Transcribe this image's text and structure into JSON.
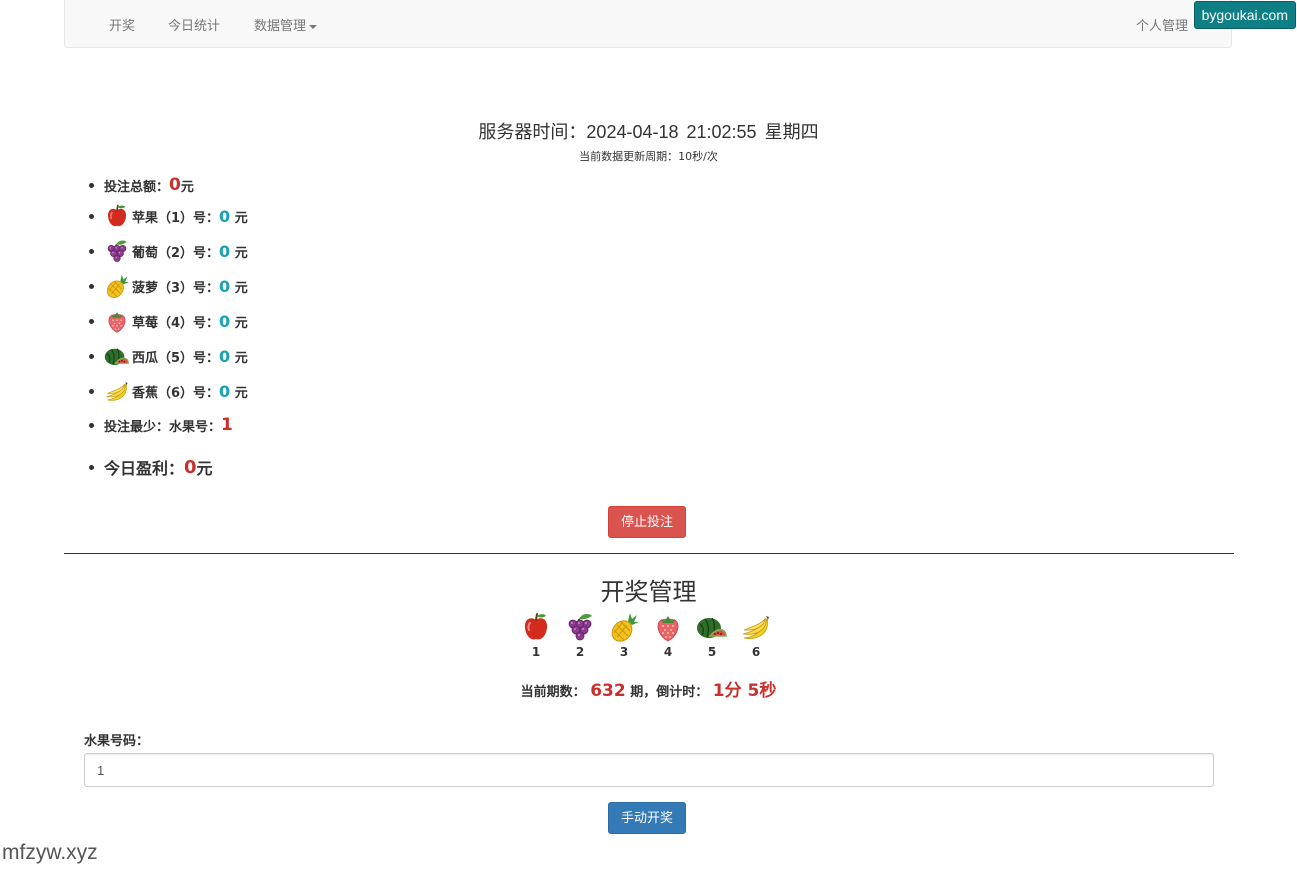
{
  "nav": {
    "items": [
      "开奖",
      "今日统计",
      "数据管理"
    ],
    "right": "个人管理"
  },
  "watermarks": {
    "top": "bygoukai.com",
    "bottom": "mfzyw.xyz"
  },
  "server_time": {
    "label": "服务器时间：",
    "date": "2024-04-18",
    "time": "21:02:55",
    "weekday": "星期四"
  },
  "refresh_text": "当前数据更新周期：10秒/次",
  "stats": {
    "total_label": "投注总额：",
    "total_value": "0",
    "unit": "元",
    "fruits": [
      {
        "icon": "apple-icon",
        "label": "苹果（1）号：",
        "value": "0",
        "unit": "元"
      },
      {
        "icon": "grape-icon",
        "label": "葡萄（2）号：",
        "value": "0",
        "unit": "元"
      },
      {
        "icon": "pineapple-icon",
        "label": "菠萝（3）号：",
        "value": "0",
        "unit": "元"
      },
      {
        "icon": "strawberry-icon",
        "label": "草莓（4）号：",
        "value": "0",
        "unit": "元"
      },
      {
        "icon": "watermelon-icon",
        "label": "西瓜（5）号：",
        "value": "0",
        "unit": "元"
      },
      {
        "icon": "banana-icon",
        "label": "香蕉（6）号：",
        "value": "0",
        "unit": "元"
      }
    ],
    "min_label": "投注最少：水果号：",
    "min_value": "1",
    "profit_label": "今日盈利：",
    "profit_value": "0",
    "profit_unit": "元"
  },
  "stop_button": "停止投注",
  "draw": {
    "title": "开奖管理",
    "fruits": [
      {
        "icon": "apple-icon",
        "num": "1"
      },
      {
        "icon": "grape-icon",
        "num": "2"
      },
      {
        "icon": "pineapple-icon",
        "num": "3"
      },
      {
        "icon": "strawberry-icon",
        "num": "4"
      },
      {
        "icon": "watermelon-icon",
        "num": "5"
      },
      {
        "icon": "banana-icon",
        "num": "6"
      }
    ],
    "period_label": "当前期数：",
    "period_value": "632",
    "period_suffix": "期，倒计时：",
    "countdown": "1分 5秒",
    "field_label": "水果号码：",
    "field_value": "1",
    "manual_button": "手动开奖"
  },
  "colors": {
    "danger": "#d9534f",
    "primary": "#337ab7",
    "highlight_red": "#c9302c",
    "teal": "#17a2b8"
  }
}
